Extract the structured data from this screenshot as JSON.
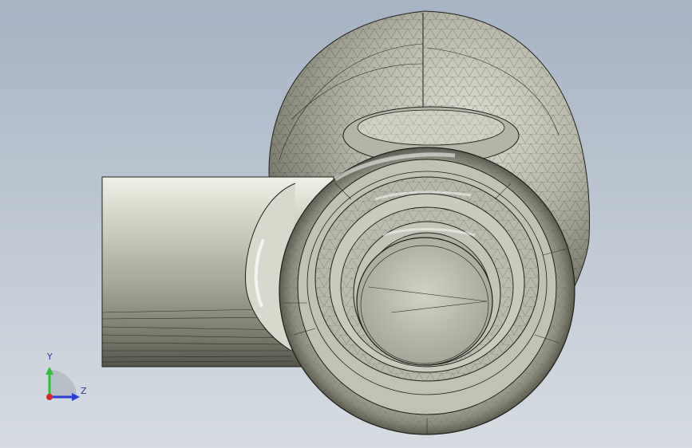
{
  "viewport": {
    "background_top": "#a6b3c4",
    "background_bottom": "#d6dce2"
  },
  "model": {
    "shade_color": "#c4c4b6",
    "edge_color": "#1e1e1a"
  },
  "triad": {
    "y_label": "Y",
    "z_label": "Z",
    "y_color": "#2fbf3a",
    "z_color": "#2b3fd6",
    "x_color": "#d6282b"
  }
}
